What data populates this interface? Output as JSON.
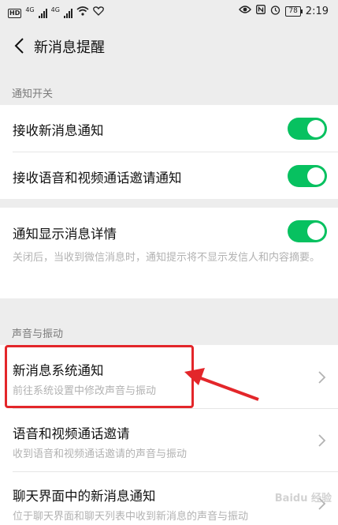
{
  "status_bar": {
    "hd": "HD",
    "network_1": "4G",
    "network_2": "4G",
    "battery": "78",
    "time": "2:19"
  },
  "header": {
    "title": "新消息提醒"
  },
  "sections": {
    "notify_switch": "通知开关",
    "sound_vibration": "声音与振动"
  },
  "toggles": {
    "receive_new_msg": "接收新消息通知",
    "receive_call_invite": "接收语音和视频通话邀请通知",
    "show_detail": "通知显示消息详情",
    "show_detail_desc": "关闭后，当收到微信消息时，通知提示将不显示发信人和内容摘要。"
  },
  "items": [
    {
      "title": "新消息系统通知",
      "subtitle": "前往系统设置中修改声音与振动"
    },
    {
      "title": "语音和视频通话邀请",
      "subtitle": "收到语音和视频通话邀请的声音与振动"
    },
    {
      "title": "聊天界面中的新消息通知",
      "subtitle": "位于聊天界面和聊天列表中收到新消息的声音与振动"
    }
  ],
  "colors": {
    "accent": "#07c160",
    "highlight": "#e3262a"
  },
  "watermark": "Baidu 经验"
}
